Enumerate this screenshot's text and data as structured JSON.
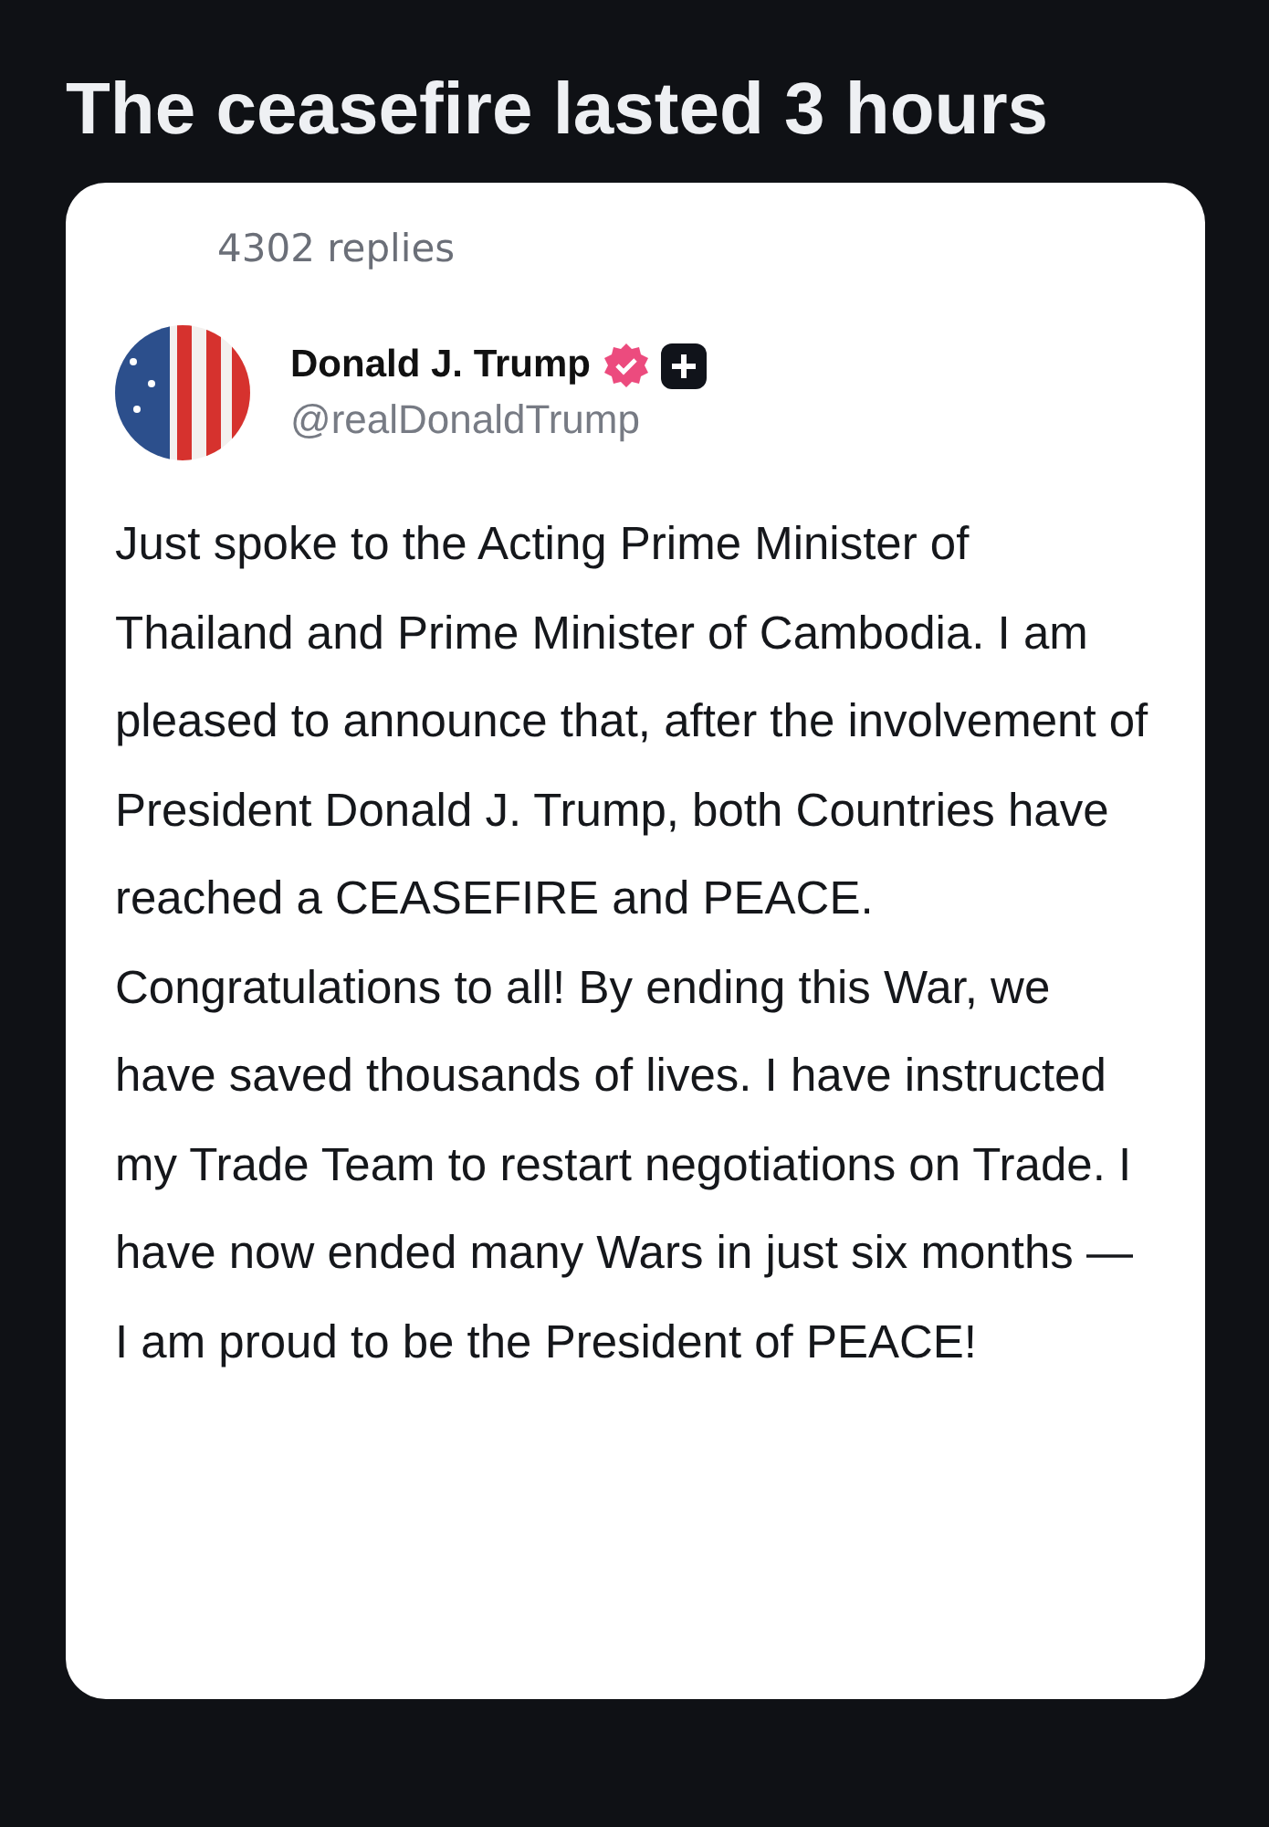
{
  "headline": "The ceasefire lasted 3 hours",
  "post": {
    "replies": "4302 replies",
    "author": {
      "name": "Donald J. Trump",
      "verified": true,
      "handle": "@realDonaldTrump"
    },
    "text": "Just spoke to the Acting Prime Minister of Thailand and Prime Minister of Cambodia. I am pleased to announce that, after the involvement of President Donald J. Trump, both Countries have reached a CEASEFIRE and PEACE. Congratulations to all! By ending this War, we have saved thousands of lives. I have instructed my Trade Team to restart negotiations on Trade. I have now ended many Wars in just six months — I am proud to be the President of PEACE!"
  }
}
